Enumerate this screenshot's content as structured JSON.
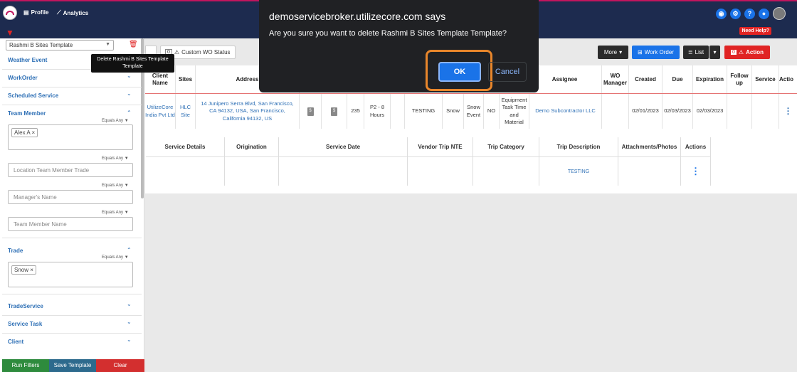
{
  "nav": {
    "profile": "Profile",
    "analytics": "Analytics",
    "need_help": "Need Help?"
  },
  "sidebar": {
    "template_value": "Rashmi B Sites Template",
    "tooltip": "Delete Rashmi B Sites Template Template",
    "sections": {
      "weather_event": "Weather Event",
      "workorder": "WorkOrder",
      "scheduled_service": "Scheduled Service",
      "team_member": "Team Member",
      "trade": "Trade",
      "trade_service": "TradeService",
      "service_task": "Service Task",
      "client": "Client"
    },
    "equals_any": "Equals Any",
    "team_member_chip": "Alex A",
    "location_placeholder": "Location Team Member Trade",
    "manager_placeholder": "Manager's Name",
    "team_member_placeholder": "Team Member Name",
    "trade_chip": "Snow",
    "run_filters": "Run Filters",
    "save_template": "Save Template",
    "clear": "Clear"
  },
  "toolbar": {
    "custom_count": "0",
    "custom_status": "Custom WO Status",
    "more": "More",
    "work_order": "Work Order",
    "list": "List",
    "action_count": "0",
    "action": "Action"
  },
  "table": {
    "headers": [
      "Client Name",
      "Sites",
      "Address",
      "Assignee",
      "WO Manager",
      "Created",
      "Due",
      "Expiration",
      "Follow up",
      "Service",
      "Actio"
    ],
    "row": {
      "client": "UtilizeCore India Pvt Ltd",
      "site": "HLC Site",
      "address": "14 Junipero Serra Blvd, San Francisco, CA 94132, USA, San Francisco, California 94132, US",
      "qty": "235",
      "priority": "P2 - 8 Hours",
      "status": "TESTING",
      "trade": "Snow",
      "event": "Snow Event",
      "flag": "NO",
      "billing": "Equipment Task Time and Material",
      "assignee": "Demo Subcontractor LLC",
      "created": "02/01/2023",
      "due": "02/03/2023",
      "expiration": "02/03/2023"
    }
  },
  "subtable": {
    "headers": [
      "Service Details",
      "Origination",
      "Service Date",
      "Vendor Trip NTE",
      "Trip Category",
      "Trip Description",
      "Attachments/Photos",
      "Actions"
    ],
    "trip_description": "TESTING"
  },
  "dialog": {
    "title": "demoservicebroker.utilizecore.com says",
    "message": "Are you sure you want to delete Rashmi B Sites Template Template?",
    "ok": "OK",
    "cancel": "Cancel"
  }
}
